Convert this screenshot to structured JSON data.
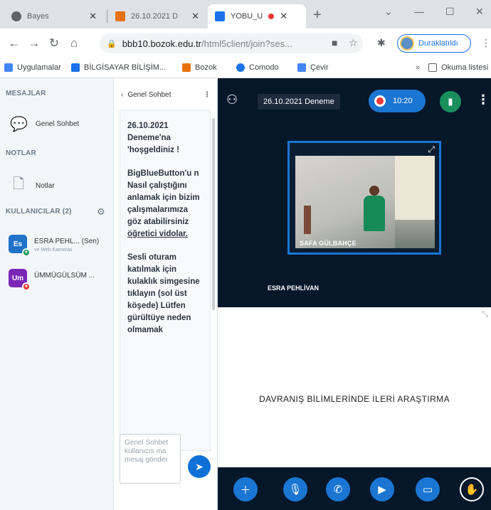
{
  "browser": {
    "tabs": [
      {
        "title": "Bayes",
        "active": false
      },
      {
        "title": "26.10.2021 D",
        "active": false
      },
      {
        "title": "YOBU_U",
        "active": true
      }
    ],
    "new_tab_glyph": "+",
    "url_host": "bbb10.bozok.edu.tr",
    "url_path": "/html5client/join?ses...",
    "profile_label": "Duraklatıldı",
    "bookmarks": [
      {
        "label": "Uygulamalar",
        "color": "#4285f4"
      },
      {
        "label": "BİLGİSAYAR BİLİŞİM...",
        "color": "#1a73e8"
      },
      {
        "label": "Bozok",
        "color": "#e8710a"
      },
      {
        "label": "Comodo",
        "color": "#1a73e8"
      },
      {
        "label": "Çevir",
        "color": "#4285f4"
      }
    ],
    "reading_list": "Okuma listesi"
  },
  "sidebar": {
    "messages_heading": "MESAJLAR",
    "public_chat": "Genel Sohbet",
    "notes_heading": "NOTLAR",
    "notes": "Notlar",
    "users_heading": "KULLANICILAR (2)",
    "users": [
      {
        "initials": "Es",
        "name": "ESRA PEHL... (Sen)",
        "sub": "ve Web Kameras",
        "color": "#2172c9",
        "badge_color": "#1b9e5a"
      },
      {
        "initials": "Um",
        "name": "ÜMMÜGÜLSÜM ...",
        "sub": "",
        "color": "#7a27b5",
        "badge_color": "#e53935"
      }
    ]
  },
  "chat": {
    "title": "Genel Sohbet",
    "welcome": "26.10.2021 Deneme'na 'hoşgeldiniz !",
    "intro": "BigBlueButton'u n Nasıl çalıştığını anlamak için bizim çalışmalarımıza göz atabilirsiniz",
    "link": "öğretici vidolar.",
    "audio_tip": "Sesli oturam katılmak için kulaklık simgesine tıklayın (sol üst köşede) Lütfen gürültüye neden olmamak",
    "input_placeholder": "Genel Sohbet kullanıcıs ına mesaj gönder"
  },
  "main": {
    "meeting_name": "26.10.2021 Deneme",
    "record_time": "10:20",
    "webcam_name": "SAFA GÜLBAHÇE",
    "second_label": "ESRA PEHLİVAN",
    "presentation_title": "DAVRANIŞ BİLİMLERİNDE İLERİ ARAŞTIRMA"
  }
}
